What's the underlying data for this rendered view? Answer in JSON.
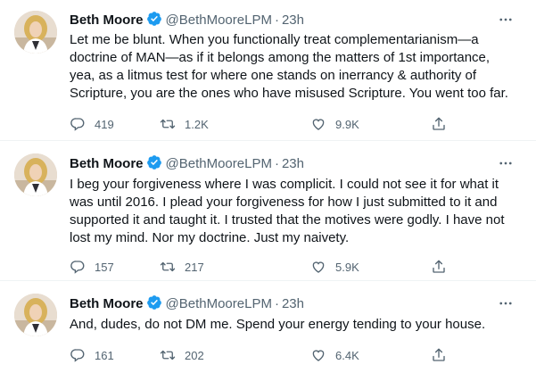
{
  "tweets": [
    {
      "author": "Beth Moore",
      "handle": "@BethMooreLPM",
      "separator": "·",
      "time": "23h",
      "lines": [
        "Let me be blunt. When you functionally treat complementarianism—a",
        "doctrine of MAN—as if it belongs among the matters of 1st importance,",
        "yea, as a litmus test for where one stands on inerrancy & authority of",
        "Scripture, you are the ones who have misused Scripture. You went too far."
      ],
      "replies": "419",
      "retweets": "1.2K",
      "likes": "9.9K"
    },
    {
      "author": "Beth Moore",
      "handle": "@BethMooreLPM",
      "separator": "·",
      "time": "23h",
      "lines": [
        "I beg your forgiveness where I was complicit. I could not see it for what it",
        "was until 2016. I plead your forgiveness for how I just submitted to it and",
        "supported it and taught it. I trusted that the motives were godly. I have not",
        "lost my mind. Nor my doctrine. Just my naivety."
      ],
      "replies": "157",
      "retweets": "217",
      "likes": "5.9K"
    },
    {
      "author": "Beth Moore",
      "handle": "@BethMooreLPM",
      "separator": "·",
      "time": "23h",
      "lines": [
        "And, dudes, do not DM me. Spend your energy tending to your house."
      ],
      "replies": "161",
      "retweets": "202",
      "likes": "6.4K"
    }
  ],
  "icons": {
    "verified": "verified-badge-icon",
    "more": "more-icon",
    "reply": "reply-icon",
    "retweet": "retweet-icon",
    "like": "like-icon",
    "share": "share-icon"
  },
  "colors": {
    "text": "#0f1419",
    "secondary": "#536471",
    "verified": "#1d9bf0",
    "divider": "#eff3f4"
  }
}
